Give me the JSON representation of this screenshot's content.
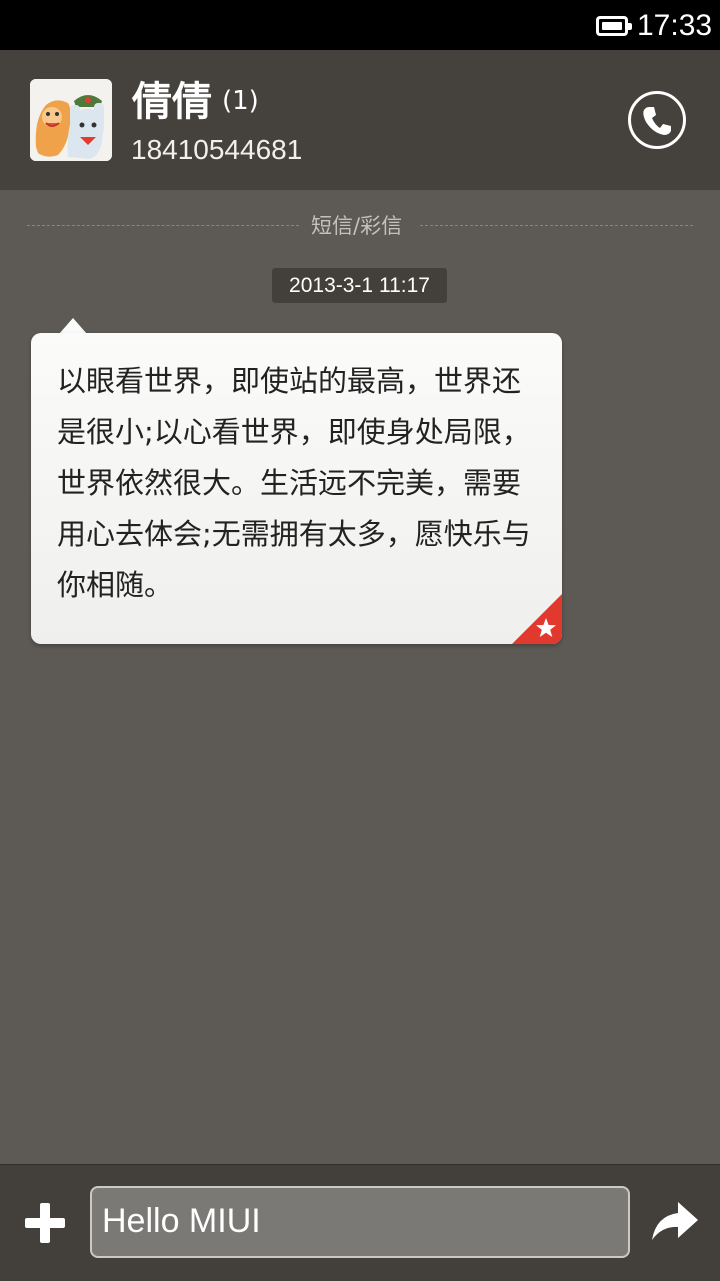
{
  "status_bar": {
    "time": "17:33",
    "battery_icon": "battery-full-icon"
  },
  "contact": {
    "name": "倩倩",
    "unread": "(1)",
    "phone": "18410544681",
    "avatar_icon": "avatar-cartoon-icon",
    "call_icon": "phone-icon"
  },
  "thread": {
    "channel_label": "短信/彩信",
    "timestamp": "2013-3-1 11:17",
    "messages": [
      {
        "text": "以眼看世界，即使站的最高，世界还是很小;以心看世界，即使身处局限，世界依然很大。生活远不完美，需要用心去体会;无需拥有太多，愿快乐与你相随。",
        "starred": true
      }
    ]
  },
  "composer": {
    "input_value": "Hello MIUI",
    "add_icon": "plus-icon",
    "send_icon": "send-arrow-icon"
  },
  "colors": {
    "background": "#5d5a55",
    "header": "#45423d",
    "star_accent": "#e2392f"
  }
}
